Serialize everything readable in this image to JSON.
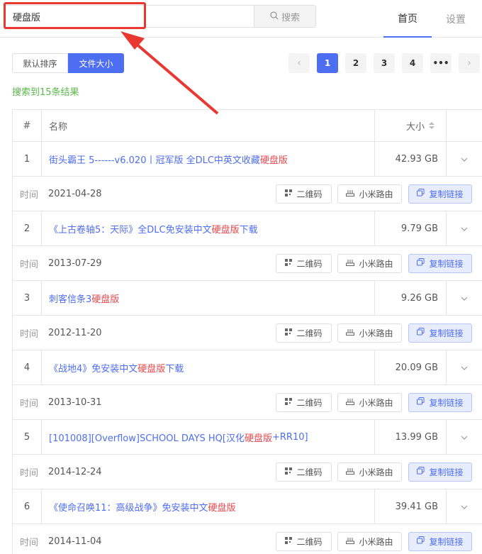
{
  "search": {
    "value": "硬盘版",
    "button_label": "搜索"
  },
  "nav": {
    "home": "首页",
    "settings": "设置"
  },
  "sort": {
    "default": "默认排序",
    "size": "文件大小"
  },
  "pagination": {
    "pages": [
      "1",
      "2",
      "3",
      "4"
    ],
    "more": "•••",
    "prev": "‹",
    "next": "›",
    "current": "1"
  },
  "result_count": "搜索到15条结果",
  "table": {
    "headers": {
      "num": "#",
      "name": "名称",
      "size": "大小"
    },
    "time_label": "时间",
    "actions": {
      "qr": "二维码",
      "router": "小米路由",
      "copy": "复制链接"
    },
    "rows": [
      {
        "num": "1",
        "name_prefix": "街头霸王 5------v6.020丨冠军版 全DLC中英文收藏",
        "highlight": "硬盘版",
        "name_suffix": "",
        "size": "42.93 GB",
        "date": "2021-04-28"
      },
      {
        "num": "2",
        "name_prefix": "《上古卷轴5：天际》全DLC免安装中文",
        "highlight": "硬盘版",
        "name_suffix": "下载",
        "size": "9.79 GB",
        "date": "2013-07-29"
      },
      {
        "num": "3",
        "name_prefix": "刺客信条3",
        "highlight": "硬盘版",
        "name_suffix": "",
        "size": "9.26 GB",
        "date": "2012-11-20"
      },
      {
        "num": "4",
        "name_prefix": "《战地4》免安装中文",
        "highlight": "硬盘版",
        "name_suffix": "下载",
        "size": "20.09 GB",
        "date": "2013-10-31"
      },
      {
        "num": "5",
        "name_prefix": "[101008][Overflow]SCHOOL DAYS HQ[汉化",
        "highlight": "硬盘版",
        "name_suffix": "+RR10]",
        "size": "13.99 GB",
        "date": "2014-12-24"
      },
      {
        "num": "6",
        "name_prefix": "《使命召唤11：高级战争》免安装中文",
        "highlight": "硬盘版",
        "name_suffix": "",
        "size": "39.41 GB",
        "date": "2014-11-04"
      }
    ]
  },
  "colors": {
    "accent": "#4e6ef2",
    "highlight": "#e5484d",
    "result_green": "#5ab94a",
    "annotation_red": "#e8382f"
  },
  "icons": {
    "search": "search-icon",
    "qr": "qr-code-icon",
    "router": "router-icon",
    "copy": "copy-icon",
    "expand": "chevron-down-icon"
  }
}
